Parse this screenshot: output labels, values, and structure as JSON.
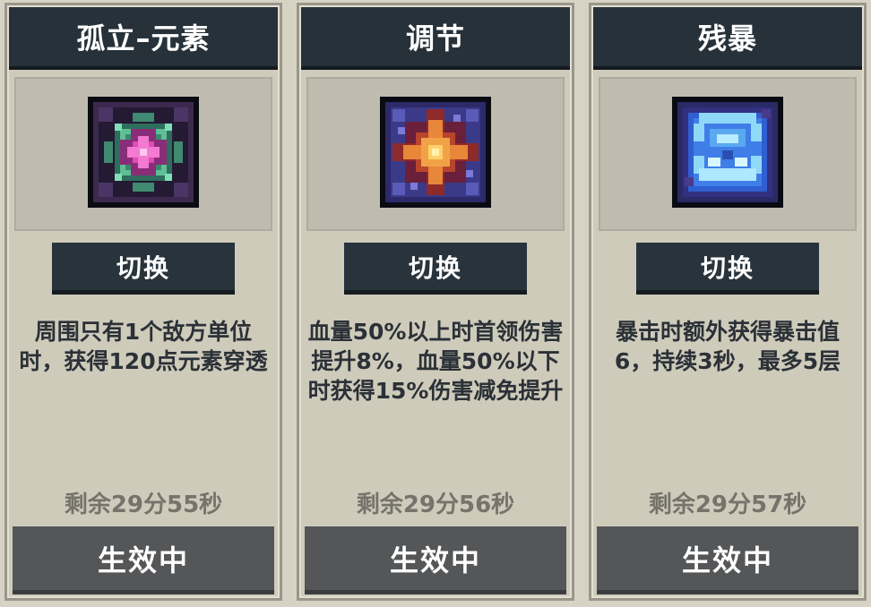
{
  "cards": [
    {
      "title": "孤立–元素",
      "icon": "green-pink-gear-rune-icon",
      "switch_label": "切换",
      "description": "周围只有1个敌方单位时，获得120点元素穿透",
      "remaining": "剩余29分55秒",
      "status_label": "生效中"
    },
    {
      "title": "调节",
      "icon": "orange-star-rune-icon",
      "switch_label": "切换",
      "description": "血量50%以上时首领伤害提升8%，血量50%以下时获得15%伤害减免提升",
      "remaining": "剩余29分56秒",
      "status_label": "生效中"
    },
    {
      "title": "残暴",
      "icon": "blue-ice-rune-icon",
      "switch_label": "切换",
      "description": "暴击时额外获得暴击值6，持续3秒，最多5层",
      "remaining": "剩余29分57秒",
      "status_label": "生效中"
    }
  ],
  "colors": {
    "title_bar": "#263139",
    "switch_button": "#28333b",
    "status_button": "#545658",
    "card_background": "#cfcbbb"
  }
}
